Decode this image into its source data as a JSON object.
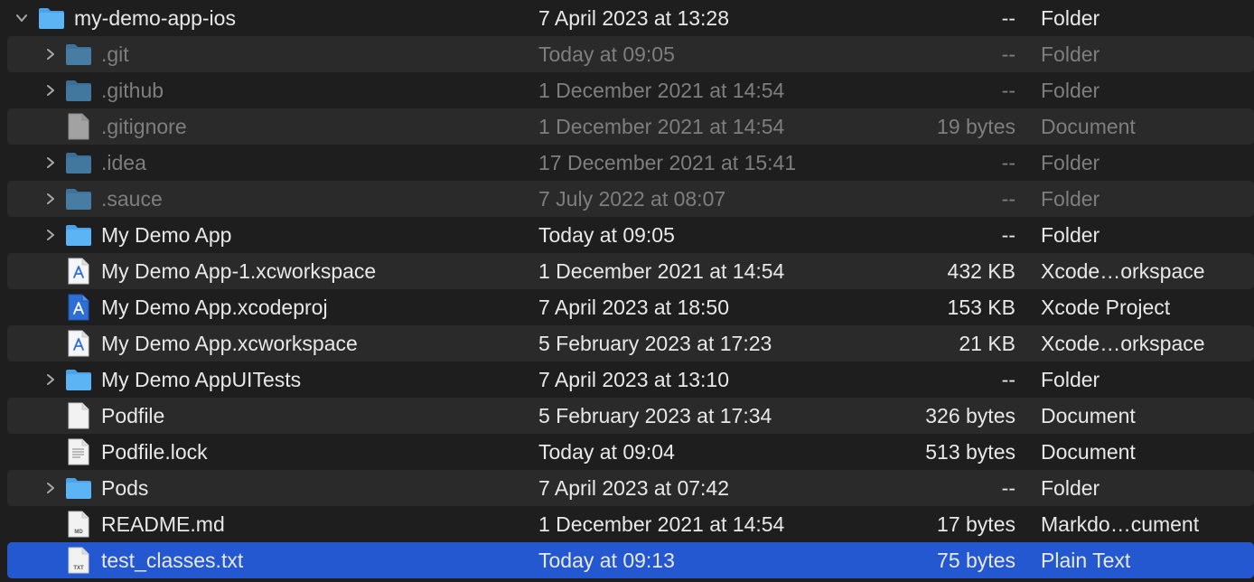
{
  "root": {
    "name": "my-demo-app-ios",
    "date": "7 April 2023 at 13:28",
    "size": "--",
    "kind": "Folder"
  },
  "items": [
    {
      "name": ".git",
      "date": "Today at 09:05",
      "size": "--",
      "kind": "Folder",
      "icon": "folder-icon"
    },
    {
      "name": ".github",
      "date": "1 December 2021 at 14:54",
      "size": "--",
      "kind": "Folder",
      "icon": "folder-icon"
    },
    {
      "name": ".gitignore",
      "date": "1 December 2021 at 14:54",
      "size": "19 bytes",
      "kind": "Document",
      "icon": "document-icon"
    },
    {
      "name": ".idea",
      "date": "17 December 2021 at 15:41",
      "size": "--",
      "kind": "Folder",
      "icon": "folder-icon"
    },
    {
      "name": ".sauce",
      "date": "7 July 2022 at 08:07",
      "size": "--",
      "kind": "Folder",
      "icon": "folder-icon"
    },
    {
      "name": "My Demo App",
      "date": "Today at 09:05",
      "size": "--",
      "kind": "Folder",
      "icon": "folder-icon"
    },
    {
      "name": "My Demo App-1.xcworkspace",
      "date": "1 December 2021 at 14:54",
      "size": "432 KB",
      "kind": "Xcode…orkspace",
      "icon": "xcworkspace-icon"
    },
    {
      "name": "My Demo App.xcodeproj",
      "date": "7 April 2023 at 18:50",
      "size": "153 KB",
      "kind": "Xcode Project",
      "icon": "xcodeproj-icon"
    },
    {
      "name": "My Demo App.xcworkspace",
      "date": "5 February 2023 at 17:23",
      "size": "21 KB",
      "kind": "Xcode…orkspace",
      "icon": "xcworkspace-icon"
    },
    {
      "name": "My Demo AppUITests",
      "date": "7 April 2023 at 13:10",
      "size": "--",
      "kind": "Folder",
      "icon": "folder-icon"
    },
    {
      "name": "Podfile",
      "date": "5 February 2023 at 17:34",
      "size": "326 bytes",
      "kind": "Document",
      "icon": "document-icon"
    },
    {
      "name": "Podfile.lock",
      "date": "Today at 09:04",
      "size": "513 bytes",
      "kind": "Document",
      "icon": "text-document-icon"
    },
    {
      "name": "Pods",
      "date": "7 April 2023 at 07:42",
      "size": "--",
      "kind": "Folder",
      "icon": "folder-icon"
    },
    {
      "name": "README.md",
      "date": "1 December 2021 at 14:54",
      "size": "17 bytes",
      "kind": "Markdo…cument",
      "icon": "markdown-document-icon",
      "badge": "MD"
    },
    {
      "name": "test_classes.txt",
      "date": "Today at 09:13",
      "size": "75 bytes",
      "kind": "Plain Text",
      "icon": "text-file-icon",
      "badge": "TXT"
    }
  ],
  "colors": {
    "background": "#1e1e1e",
    "alternate_row": "#2a2a2a",
    "selection": "#2458d0",
    "folder": "#5cb4f4",
    "dim_text": "#7e7e7e",
    "text": "#e8e8e8"
  }
}
